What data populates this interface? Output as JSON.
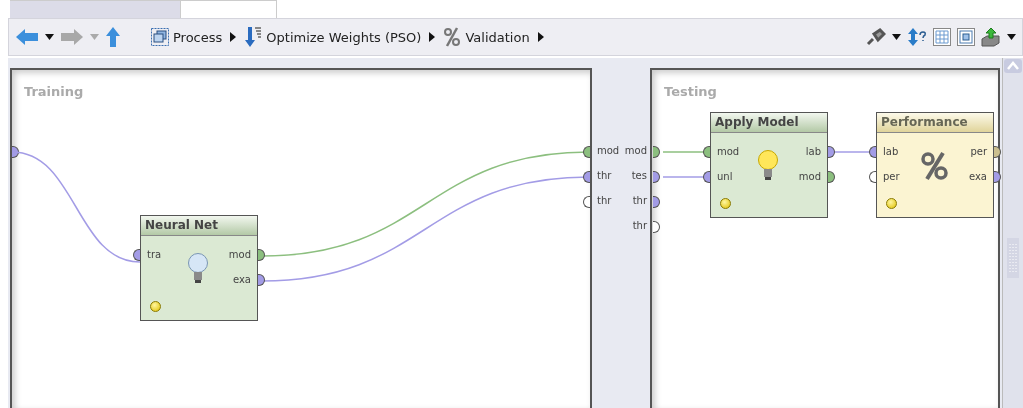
{
  "toolbar": {
    "nav": [
      {
        "kind": "back",
        "disabled": false
      },
      {
        "kind": "forward",
        "disabled": true
      },
      {
        "kind": "up",
        "disabled": false
      }
    ],
    "breadcrumbs": [
      {
        "kind": "process",
        "label": "Process"
      },
      {
        "kind": "optimize",
        "label": "Optimize Weights (PSO)"
      },
      {
        "kind": "validation",
        "label": "Validation"
      }
    ],
    "tools": [
      {
        "kind": "plug"
      },
      {
        "kind": "arrange"
      },
      {
        "kind": "grid"
      },
      {
        "kind": "fit"
      },
      {
        "kind": "export"
      }
    ]
  },
  "panels": [
    {
      "title": "Training"
    },
    {
      "title": "Testing"
    }
  ],
  "subprocess_ports": {
    "training_outputs": [
      {
        "label": "mod",
        "color": "#8cbf7f"
      },
      {
        "label": "thr",
        "color": "#a39ce6"
      },
      {
        "label": "thr",
        "color": "#ffffff"
      }
    ],
    "testing_inputs": [
      {
        "label": "mod",
        "color": "#8cbf7f"
      },
      {
        "label": "tes",
        "color": "#a39ce6"
      },
      {
        "label": "thr",
        "color": "#a39ce6"
      },
      {
        "label": "thr",
        "color": "#ffffff"
      }
    ]
  },
  "operators": [
    {
      "kind": "learner",
      "name": "Neural Net",
      "inputs": [
        {
          "label": "tra",
          "color": "#a39ce6"
        }
      ],
      "outputs": [
        {
          "label": "mod",
          "color": "#8cbf7f"
        },
        {
          "label": "exa",
          "color": "#a39ce6"
        }
      ]
    },
    {
      "kind": "applier",
      "name": "Apply Model",
      "inputs": [
        {
          "label": "mod",
          "color": "#8cbf7f"
        },
        {
          "label": "unl",
          "color": "#a39ce6"
        }
      ],
      "outputs": [
        {
          "label": "lab",
          "color": "#a39ce6"
        },
        {
          "label": "mod",
          "color": "#8cbf7f"
        }
      ]
    },
    {
      "kind": "evaluator",
      "name": "Performance",
      "inputs": [
        {
          "label": "lab",
          "color": "#a39ce6"
        },
        {
          "label": "per",
          "color": "#ffffff"
        }
      ],
      "outputs": [
        {
          "label": "per",
          "color": "#cbbf8e"
        },
        {
          "label": "exa",
          "color": "#a39ce6"
        }
      ]
    }
  ]
}
